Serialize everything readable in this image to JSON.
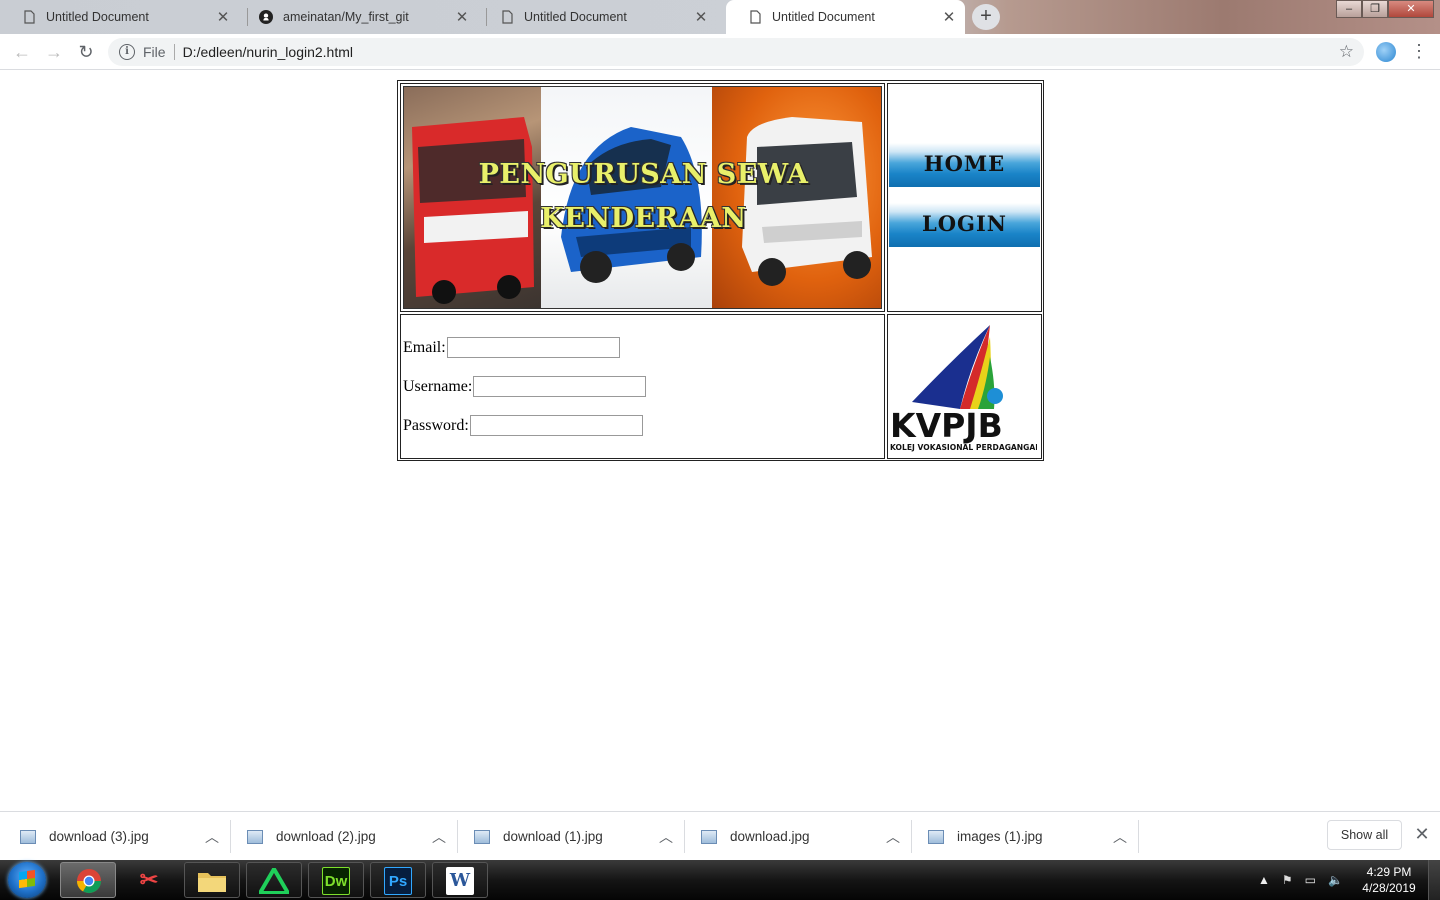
{
  "browser": {
    "tabs": [
      {
        "title": "Untitled Document",
        "icon": "document-icon",
        "active": false
      },
      {
        "title": "ameinatan/My_first_git",
        "icon": "github-icon",
        "active": false
      },
      {
        "title": "Untitled Document",
        "icon": "document-icon",
        "active": false
      },
      {
        "title": "Untitled Document",
        "icon": "document-icon",
        "active": true
      }
    ],
    "new_tab_label": "+",
    "address": {
      "scheme_label": "File",
      "url": "D:/edleen/nurin_login2.html"
    }
  },
  "page": {
    "banner_title_line1": "PENGURUSAN SEWA",
    "banner_title_line2": "KENDERAAN",
    "nav": {
      "home_label": "HOME",
      "login_label": "LOGIN"
    },
    "form": {
      "email_label": "Email:",
      "username_label": "Username:",
      "password_label": "Password:",
      "email_value": "",
      "username_value": "",
      "password_value": ""
    },
    "logo": {
      "text": "KVPJB",
      "subtitle": "KOLEJ VOKASIONAL PERDAGANGAN"
    }
  },
  "downloads": {
    "items": [
      {
        "name": "download (3).jpg"
      },
      {
        "name": "download (2).jpg"
      },
      {
        "name": "download (1).jpg"
      },
      {
        "name": "download.jpg"
      },
      {
        "name": "images (1).jpg"
      }
    ],
    "show_all_label": "Show all"
  },
  "taskbar": {
    "apps": [
      {
        "name": "Chrome",
        "icon": "chrome-icon"
      },
      {
        "name": "Snipping Tool",
        "icon": "scissors-icon"
      },
      {
        "name": "File Explorer",
        "icon": "folder-icon"
      },
      {
        "name": "Atom-like editor",
        "icon": "triangle-app-icon"
      },
      {
        "name": "Dreamweaver",
        "icon": "dreamweaver-icon",
        "glyph": "Dw"
      },
      {
        "name": "Photoshop",
        "icon": "photoshop-icon",
        "glyph": "Ps"
      },
      {
        "name": "Word",
        "icon": "word-icon",
        "glyph": "W"
      }
    ],
    "clock": {
      "time": "4:29 PM",
      "date": "4/28/2019"
    }
  },
  "colors": {
    "nav_button_blue": "#1a84c8",
    "banner_title_yellow": "#e9f06a"
  }
}
